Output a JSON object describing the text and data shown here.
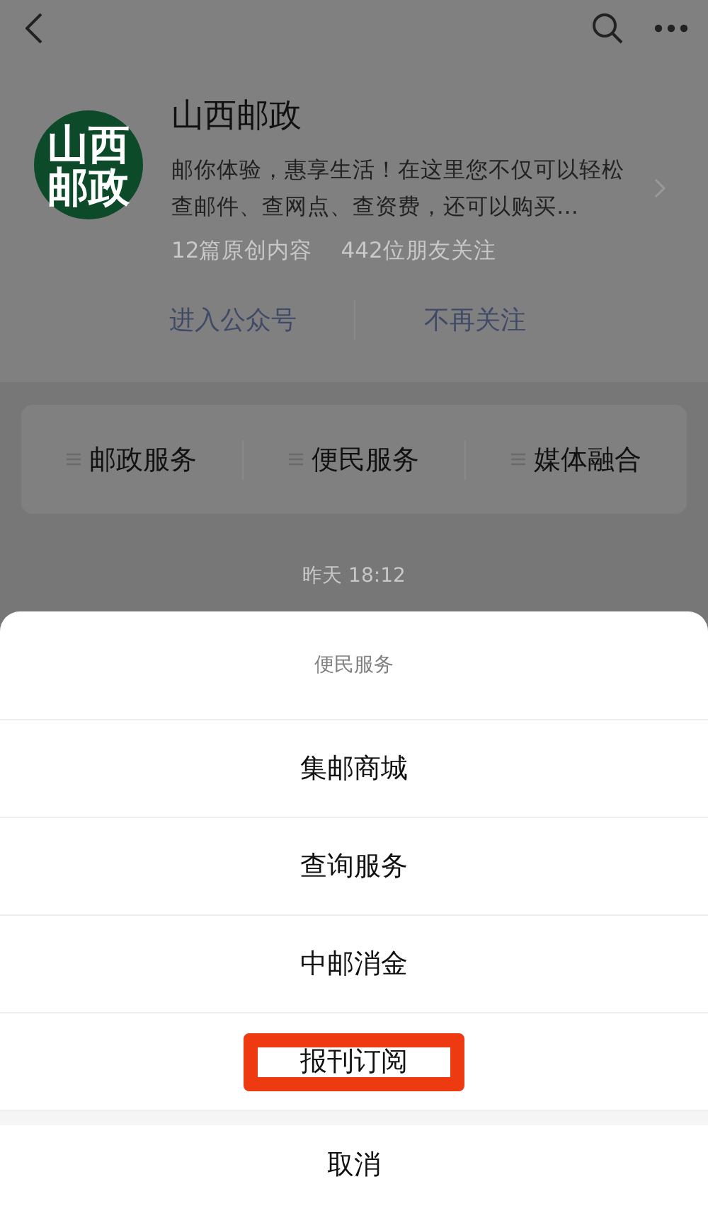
{
  "account": {
    "logo_lines": [
      "山西",
      "邮政"
    ],
    "name": "山西邮政",
    "description": "邮你体验，惠享生活！在这里您不仅可以轻松查邮件、查网点、查资费，还可以购买…",
    "stats": [
      "12篇原创内容",
      "442位朋友关注"
    ],
    "actions": [
      "进入公众号",
      "不再关注"
    ]
  },
  "menu_bar": [
    {
      "label": "邮政服务"
    },
    {
      "label": "便民服务"
    },
    {
      "label": "媒体融合"
    }
  ],
  "timestamp": "昨天 18:12",
  "sheet": {
    "title": "便民服务",
    "items": [
      {
        "label": "集邮商城",
        "highlighted": false
      },
      {
        "label": "查询服务",
        "highlighted": false
      },
      {
        "label": "中邮消金",
        "highlighted": false
      },
      {
        "label": "报刊订阅",
        "highlighted": true
      }
    ],
    "cancel": "取消"
  }
}
